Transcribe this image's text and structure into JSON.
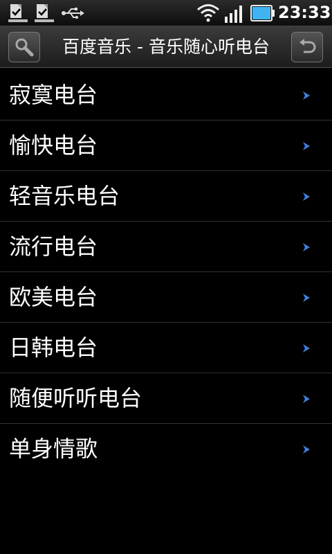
{
  "status_bar": {
    "time": "23:33",
    "icons": [
      "notification-download-icon",
      "notification-download-icon",
      "usb-icon",
      "wifi-icon",
      "signal-icon",
      "battery-icon"
    ]
  },
  "title_bar": {
    "title": "百度音乐 - 音乐随心听电台",
    "left_icon": "search-icon",
    "right_icon": "back-icon"
  },
  "stations": [
    {
      "label": "寂寞电台"
    },
    {
      "label": "愉快电台"
    },
    {
      "label": "轻音乐电台"
    },
    {
      "label": "流行电台"
    },
    {
      "label": "欧美电台"
    },
    {
      "label": "日韩电台"
    },
    {
      "label": "随便听听电台"
    },
    {
      "label": "单身情歌"
    }
  ],
  "colors": {
    "background": "#000000",
    "chevron": "#3f7fe0",
    "battery": "#3fb4f0"
  }
}
